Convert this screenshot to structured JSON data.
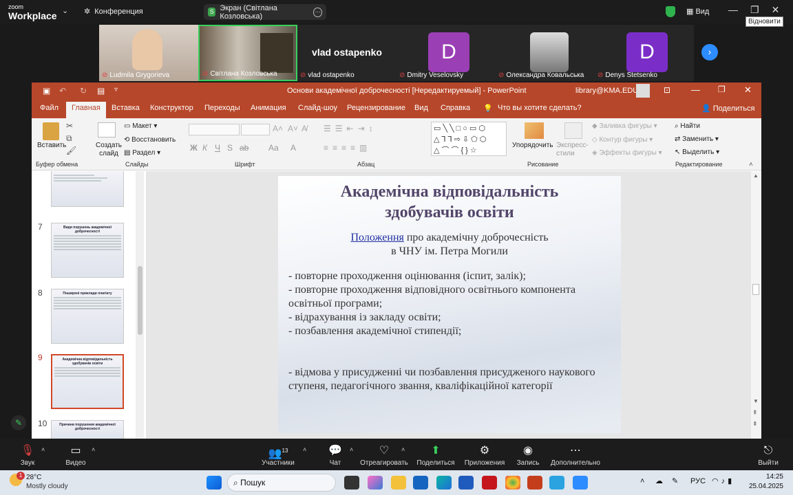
{
  "zoom": {
    "brand_top": "zoom",
    "brand": "Workplace",
    "meeting": "Конференция",
    "share": "Экран (Світлана Козловська)",
    "view": "Вид",
    "restore_tip": "Відновити"
  },
  "participants": [
    {
      "name": "Ludmila Grygorieva"
    },
    {
      "name": "Світлана Козловська"
    },
    {
      "name": "vlad ostapenko",
      "display": "vlad ostapenko"
    },
    {
      "name": "Dmitry Veselovsky",
      "initial": "D"
    },
    {
      "name": "Олександра Ковальська"
    },
    {
      "name": "Denys Stetsenko",
      "initial": "D"
    }
  ],
  "ppt": {
    "doc_title": "Основи академічної доброчесності [Нередактируемый]  -  PowerPoint",
    "account": "library@KMA.EDU",
    "tabs": [
      "Файл",
      "Главная",
      "Вставка",
      "Конструктор",
      "Переходы",
      "Анимация",
      "Слайд-шоу",
      "Рецензирование",
      "Вид",
      "Справка",
      "Что вы хотите сделать?"
    ],
    "share_btn": "Поделиться",
    "ribbon": {
      "paste": "Вставить",
      "new_slide": "Создать слайд",
      "layout": "Макет",
      "reset": "Восстановить",
      "section": "Раздел",
      "groups": [
        "Буфер обмена",
        "Слайды",
        "Шрифт",
        "Абзац",
        "Рисование",
        "Редактирование"
      ],
      "arrange": "Упорядочить",
      "quick_styles": "Экспресс-стили",
      "fill": "Заливка фигуры",
      "outline": "Контур фигуры",
      "effects": "Эффекты фигуры",
      "find": "Найти",
      "replace": "Заменить",
      "select": "Выделить",
      "font_btns": [
        "Ж",
        "К",
        "Ч",
        "S",
        "ab",
        "Aa",
        "A"
      ]
    },
    "thumbs": [
      {
        "num": "7",
        "title": "Види порушень академічної доброчесності"
      },
      {
        "num": "8",
        "title": "Поширені приклади плагіату"
      },
      {
        "num": "9",
        "title": "Академічна відповідальність здобувачів освіти"
      },
      {
        "num": "10",
        "title": "Причини порушення академічної доброчесності"
      }
    ],
    "slide": {
      "title1": "Академічна відповідальність",
      "title2": "здобувачів освіти",
      "link": "Положення",
      "sub1": " про академічну доброчесність",
      "sub2": "в ЧНУ ім. Петра Могили",
      "bullets": [
        "- повторне проходження оцінювання (іспит, залік);",
        "- повторне проходження відповідного освітнього компонента освітньої програми;",
        "- відрахування із закладу освіти;",
        "- позбавлення академічної стипендії;"
      ],
      "last": "- відмова у присудженні чи позбавлення присудженого наукового ступеня, педагогічного звання, кваліфікаційної категорії"
    }
  },
  "toolbar": {
    "audio": "Звук",
    "video": "Видео",
    "participants": "Участники",
    "participants_count": "13",
    "chat": "Чат",
    "react": "Отреагировать",
    "share": "Поделиться",
    "apps": "Приложения",
    "record": "Запись",
    "more": "Дополнительно",
    "leave": "Выйти"
  },
  "taskbar": {
    "temp": "28°C",
    "weather": "Mostly cloudy",
    "search": "Пошук",
    "lang": "РУС",
    "time": "14:25",
    "date": "25.04.2025",
    "badge": "1"
  }
}
